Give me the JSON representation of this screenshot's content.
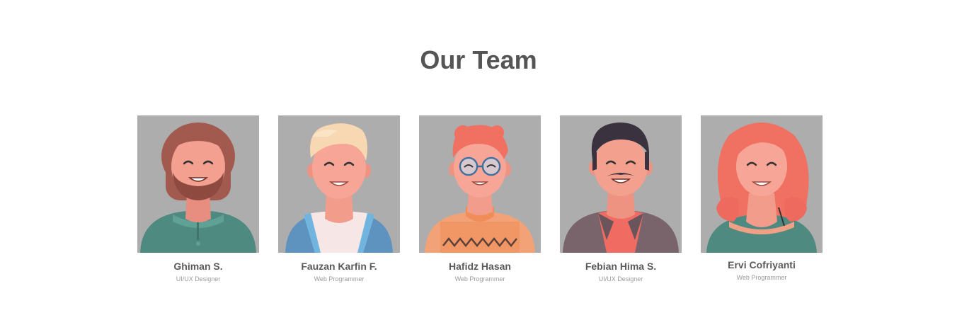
{
  "section": {
    "title": "Our Team"
  },
  "members": [
    {
      "name": "Ghiman S.",
      "role": "UI/UX Designer"
    },
    {
      "name": "Fauzan Karfin F.",
      "role": "Web Programmer"
    },
    {
      "name": "Hafidz Hasan",
      "role": "Web Programmer"
    },
    {
      "name": "Febian Hima S.",
      "role": "UI/UX Designer"
    },
    {
      "name": "Ervi Cofriyanti",
      "role": "Web Programmer"
    }
  ],
  "colors": {
    "photo_bg": "#adadad",
    "title": "#555555",
    "name": "#5a5a5a",
    "role": "#9a9a9a"
  }
}
